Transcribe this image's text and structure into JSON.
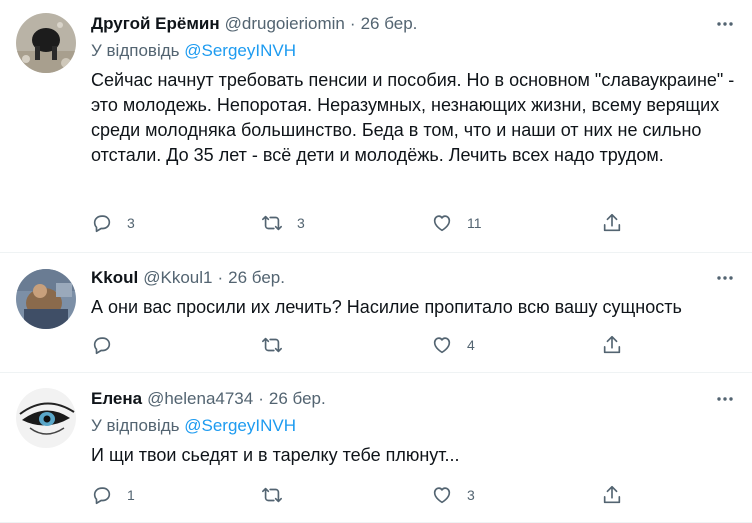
{
  "tweets": [
    {
      "author_name": "Другой Ерёмин",
      "handle": "@drugoieriomin",
      "separator": "·",
      "time": "26 бер.",
      "reply_to_prefix": "У відповідь",
      "reply_to_handle": "@SergeyINVH",
      "text": "Сейчас начнут требовать пенсии и пособия. Но в основном \"славаукраине\" - это молодежь. Непоротая. Неразумных, незнающих жизни, всему верящих среди молодняка большинство. Беда в том, что и наши от них не сильно отстали. До 35 лет - всё дети и молодёжь. Лечить всех надо трудом.",
      "reply_count": "3",
      "retweet_count": "3",
      "like_count": "11"
    },
    {
      "author_name": "Kkoul",
      "handle": "@Kkoul1",
      "separator": "·",
      "time": "26 бер.",
      "text": "А они вас просили их лечить? Насилие пропитало всю вашу сущность",
      "reply_count": "",
      "retweet_count": "",
      "like_count": "4"
    },
    {
      "author_name": "Елена",
      "handle": "@helena4734",
      "separator": "·",
      "time": "26 бер.",
      "reply_to_prefix": "У відповідь",
      "reply_to_handle": "@SergeyINVH",
      "text": "И щи твои сьедят и в тарелку тебе плюнут...",
      "reply_count": "1",
      "retweet_count": "",
      "like_count": "3"
    }
  ],
  "colors": {
    "text": "#0f1419",
    "secondary": "#536471",
    "link": "#1d9bf0",
    "divider": "#eff3f4"
  }
}
